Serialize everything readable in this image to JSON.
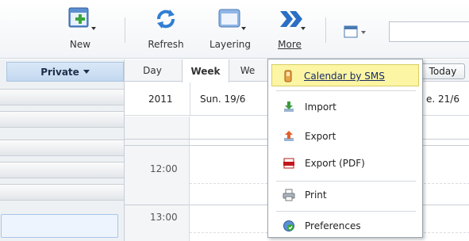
{
  "toolbar": {
    "new_label": "New",
    "refresh_label": "Refresh",
    "layering_label": "Layering",
    "more_label": "More",
    "search_value": "",
    "icons": {
      "new": "calendar-add-icon",
      "refresh": "refresh-icon",
      "layering": "layers-icon",
      "more": "double-chevron-right-icon",
      "view": "calendar-view-icon"
    }
  },
  "sidebar": {
    "calendar_filter": "Private"
  },
  "calendar": {
    "tabs": {
      "day": "Day",
      "week": "Week",
      "month_partial": "We"
    },
    "today_label": "Today",
    "year": "2011",
    "days": [
      "Sun. 19/6",
      "e. 21/6"
    ],
    "hours": [
      "12:00",
      "13:00"
    ]
  },
  "more_menu": {
    "items": [
      {
        "label": "Calendar by SMS",
        "icon": "mobile-phone-icon"
      },
      {
        "label": "Import",
        "icon": "import-icon"
      },
      {
        "label": "Export",
        "icon": "export-icon"
      },
      {
        "label": "Export (PDF)",
        "icon": "pdf-icon"
      },
      {
        "label": "Print",
        "icon": "printer-icon"
      },
      {
        "label": "Preferences",
        "icon": "preferences-icon"
      }
    ]
  },
  "colors": {
    "menu_highlight": "#fbf5a4",
    "accent_blue": "#1f5fa8",
    "sidebar_header": "#c3d8ef"
  }
}
